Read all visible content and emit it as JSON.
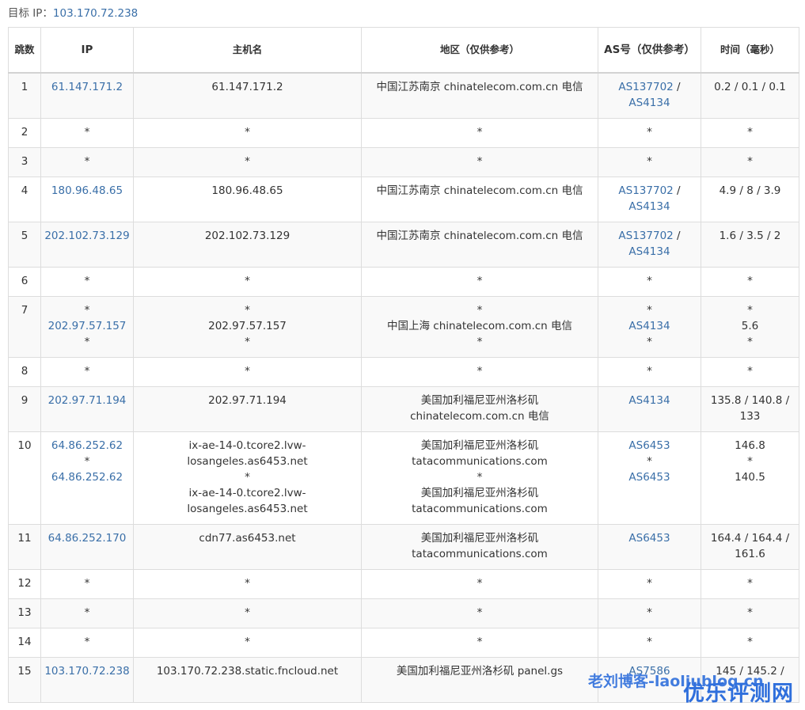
{
  "target": {
    "label": "目标 IP：",
    "ip": "103.170.72.238"
  },
  "headers": [
    "跳数",
    "IP",
    "主机名",
    "地区（仅供参考）",
    "AS号（仅供参考）",
    "时间（毫秒）"
  ],
  "rows": [
    {
      "hop": "1",
      "size": "h2",
      "ip": [
        "61.147.171.2"
      ],
      "host": [
        "61.147.171.2"
      ],
      "region": [
        "中国江苏南京 chinatelecom.com.cn 电信"
      ],
      "as": [
        [
          "AS137702",
          " / "
        ],
        [
          "AS4134"
        ]
      ],
      "time": [
        "0.2 / 0.1 / 0.1"
      ]
    },
    {
      "hop": "2",
      "size": "h1",
      "ip": [
        "*"
      ],
      "host": [
        "*"
      ],
      "region": [
        "*"
      ],
      "as": [
        [
          "*"
        ]
      ],
      "time": [
        "*"
      ]
    },
    {
      "hop": "3",
      "size": "h1",
      "ip": [
        "*"
      ],
      "host": [
        "*"
      ],
      "region": [
        "*"
      ],
      "as": [
        [
          "*"
        ]
      ],
      "time": [
        "*"
      ]
    },
    {
      "hop": "4",
      "size": "h2",
      "ip": [
        "180.96.48.65"
      ],
      "host": [
        "180.96.48.65"
      ],
      "region": [
        "中国江苏南京 chinatelecom.com.cn 电信"
      ],
      "as": [
        [
          "AS137702",
          " / "
        ],
        [
          "AS4134"
        ]
      ],
      "time": [
        "4.9 / 8 / 3.9"
      ]
    },
    {
      "hop": "5",
      "size": "h2",
      "ip": [
        "202.102.73.129"
      ],
      "host": [
        "202.102.73.129"
      ],
      "region": [
        "中国江苏南京 chinatelecom.com.cn 电信"
      ],
      "as": [
        [
          "AS137702",
          " / "
        ],
        [
          "AS4134"
        ]
      ],
      "time": [
        "1.6 / 3.5 / 2"
      ]
    },
    {
      "hop": "6",
      "size": "h1",
      "ip": [
        "*"
      ],
      "host": [
        "*"
      ],
      "region": [
        "*"
      ],
      "as": [
        [
          "*"
        ]
      ],
      "time": [
        "*"
      ]
    },
    {
      "hop": "7",
      "size": "h3",
      "ip": [
        "*",
        "202.97.57.157",
        "*"
      ],
      "host": [
        "*",
        "202.97.57.157",
        "*"
      ],
      "region": [
        "*",
        "中国上海 chinatelecom.com.cn 电信",
        "*"
      ],
      "as": [
        [
          "*"
        ],
        [
          "AS4134"
        ],
        [
          "*"
        ]
      ],
      "time": [
        "*",
        "5.6",
        "*"
      ]
    },
    {
      "hop": "8",
      "size": "h1",
      "ip": [
        "*"
      ],
      "host": [
        "*"
      ],
      "region": [
        "*"
      ],
      "as": [
        [
          "*"
        ]
      ],
      "time": [
        "*"
      ]
    },
    {
      "hop": "9",
      "size": "h2",
      "ip": [
        "202.97.71.194"
      ],
      "host": [
        "202.97.71.194"
      ],
      "region": [
        "美国加利福尼亚州洛杉矶",
        "chinatelecom.com.cn 电信"
      ],
      "as": [
        [
          "AS4134"
        ]
      ],
      "time": [
        "135.8 / 140.8 /",
        "133"
      ]
    },
    {
      "hop": "10",
      "size": "h4",
      "ip": [
        "64.86.252.62",
        "*",
        "64.86.252.62"
      ],
      "host": [
        "ix-ae-14-0.tcore2.lvw-",
        "losangeles.as6453.net",
        "*",
        "ix-ae-14-0.tcore2.lvw-",
        "losangeles.as6453.net"
      ],
      "region": [
        "美国加利福尼亚州洛杉矶",
        "tatacommunications.com",
        "*",
        "美国加利福尼亚州洛杉矶",
        "tatacommunications.com"
      ],
      "as": [
        [
          "AS6453"
        ],
        [
          "*"
        ],
        [
          "AS6453"
        ]
      ],
      "time": [
        "146.8",
        "*",
        "140.5"
      ]
    },
    {
      "hop": "11",
      "size": "h2",
      "ip": [
        "64.86.252.170"
      ],
      "host": [
        "cdn77.as6453.net"
      ],
      "region": [
        "美国加利福尼亚州洛杉矶",
        "tatacommunications.com"
      ],
      "as": [
        [
          "AS6453"
        ]
      ],
      "time": [
        "164.4 / 164.4 /",
        "161.6"
      ]
    },
    {
      "hop": "12",
      "size": "h1",
      "ip": [
        "*"
      ],
      "host": [
        "*"
      ],
      "region": [
        "*"
      ],
      "as": [
        [
          "*"
        ]
      ],
      "time": [
        "*"
      ]
    },
    {
      "hop": "13",
      "size": "h1",
      "ip": [
        "*"
      ],
      "host": [
        "*"
      ],
      "region": [
        "*"
      ],
      "as": [
        [
          "*"
        ]
      ],
      "time": [
        "*"
      ]
    },
    {
      "hop": "14",
      "size": "h1",
      "ip": [
        "*"
      ],
      "host": [
        "*"
      ],
      "region": [
        "*"
      ],
      "as": [
        [
          "*"
        ]
      ],
      "time": [
        "*"
      ]
    },
    {
      "hop": "15",
      "size": "h5",
      "ip": [
        "103.170.72.238"
      ],
      "host": [
        "103.170.72.238.static.fncloud.net"
      ],
      "region": [
        "美国加利福尼亚州洛杉矶 panel.gs"
      ],
      "as": [
        [
          "AS7586"
        ]
      ],
      "time": [
        "145 / 145.2 /"
      ]
    }
  ],
  "watermark": {
    "text1": "老刘博客-laoliublog.cn",
    "text2": "优乐评测网"
  },
  "colors": {
    "link": "#3a6fa8",
    "border": "#dddddd",
    "stripe": "#f9f9f9",
    "watermark": "#2f6fdc"
  }
}
